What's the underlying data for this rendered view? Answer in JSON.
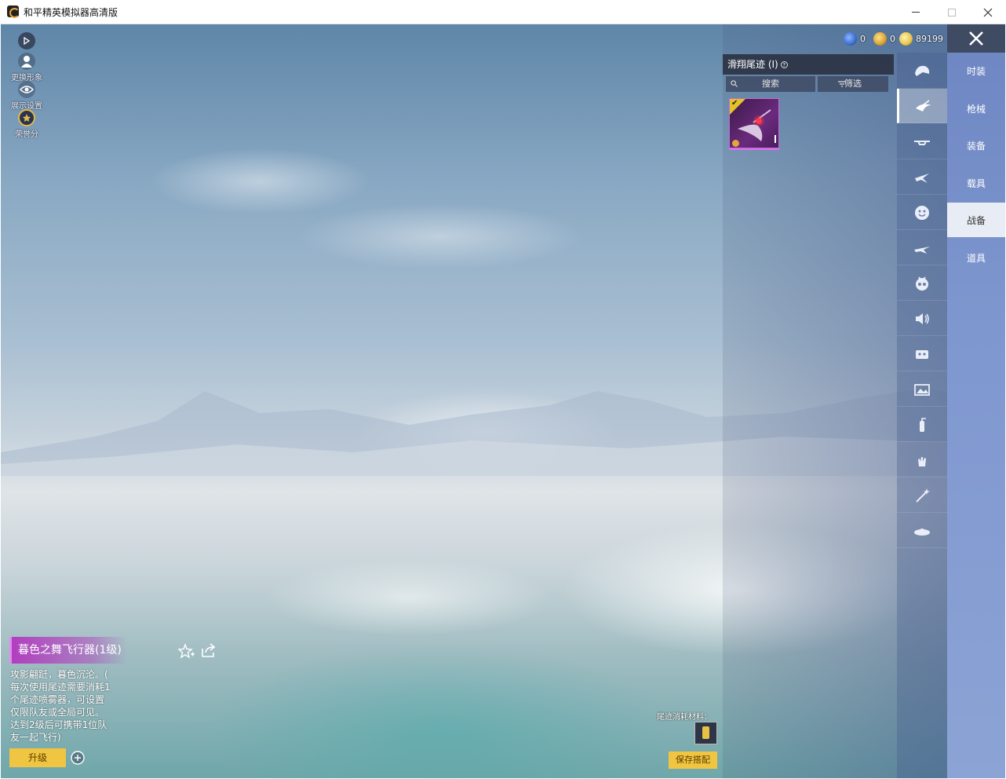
{
  "window": {
    "title": "和平精英模拟器高清版"
  },
  "left_menu": {
    "items": [
      {
        "label": ""
      },
      {
        "label": "更换形象"
      },
      {
        "label": "展示设置"
      },
      {
        "label": "荣誉分"
      }
    ]
  },
  "currency": [
    {
      "value": "0",
      "color": "#3a6fd1"
    },
    {
      "value": "0",
      "color": "#d8a232"
    },
    {
      "value": "89199",
      "color": "#e6c44c"
    }
  ],
  "panel": {
    "header": "滑翔尾迹 (I)",
    "search_label": "搜索",
    "filter_label": "筛选"
  },
  "categories": [
    {
      "icon": "helmet-icon"
    },
    {
      "icon": "glider-icon"
    },
    {
      "icon": "drone-icon"
    },
    {
      "icon": "plane-icon"
    },
    {
      "icon": "emote-icon"
    },
    {
      "icon": "jet-icon"
    },
    {
      "icon": "pet-icon"
    },
    {
      "icon": "voice-icon"
    },
    {
      "icon": "card-icon"
    },
    {
      "icon": "photo-icon"
    },
    {
      "icon": "extinguisher-icon"
    },
    {
      "icon": "hand-icon"
    },
    {
      "icon": "wand-icon"
    },
    {
      "icon": "ufo-icon"
    }
  ],
  "tabs": [
    {
      "label": "时装"
    },
    {
      "label": "枪械"
    },
    {
      "label": "装备"
    },
    {
      "label": "载具"
    },
    {
      "label": "战备"
    },
    {
      "label": "道具"
    }
  ],
  "item": {
    "title": "暮色之舞飞行器(1级)",
    "description_lines": [
      "攻影翩跹，暮色沉沦。(",
      "每次使用尾迹需要消耗1",
      "个尾迹喷雾器，可设置",
      "仅限队友或全局可见。",
      "达到2级后可携带1位队",
      "友一起飞行)"
    ],
    "upgrade_label": "升级"
  },
  "footer": {
    "material_label": "尾迹消耗材料：",
    "save_label": "保存搭配"
  },
  "colors": {
    "accent": "#f0c541",
    "rarity": "#c46bd8",
    "tab_bg": "#7e97cf"
  }
}
